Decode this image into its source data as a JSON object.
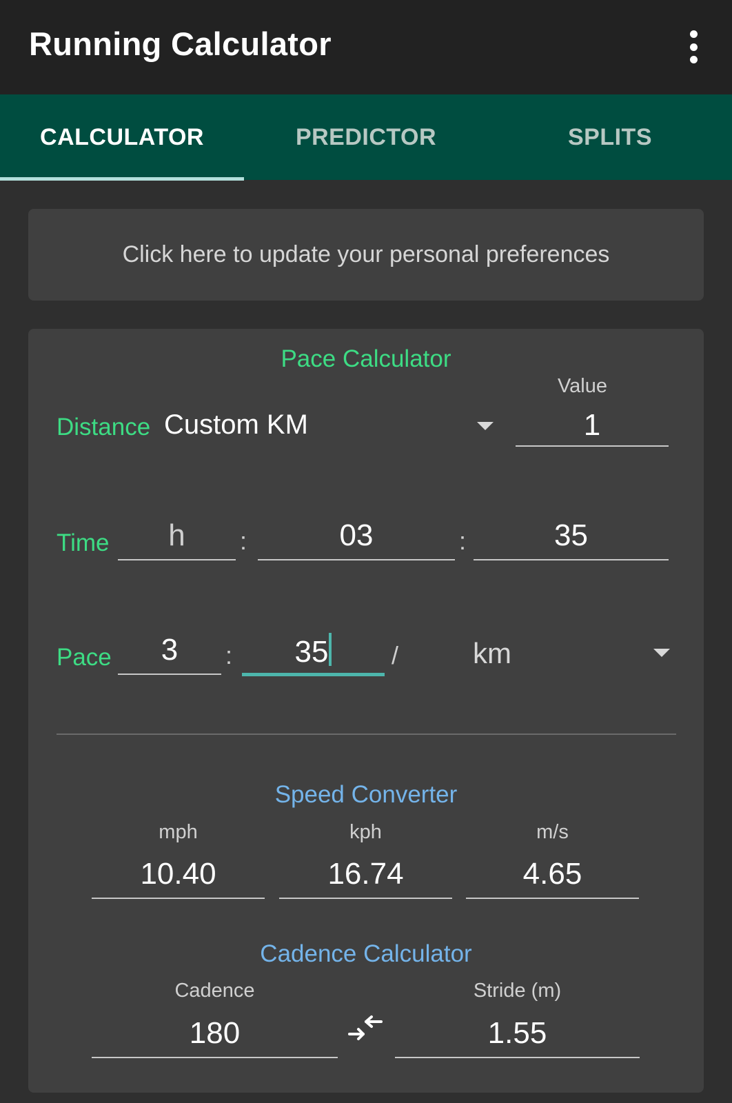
{
  "app": {
    "title": "Running Calculator"
  },
  "tabs": [
    {
      "label": "CALCULATOR",
      "active": true
    },
    {
      "label": "PREDICTOR",
      "active": false
    },
    {
      "label": "SPLITS",
      "active": false
    }
  ],
  "preferences_banner": {
    "text": "Click here to update your personal preferences"
  },
  "pace_calculator": {
    "title": "Pace Calculator",
    "distance": {
      "label": "Distance",
      "selected": "Custom KM",
      "value_label": "Value",
      "value": "1"
    },
    "time": {
      "label": "Time",
      "hours_placeholder": "h",
      "minutes": "03",
      "seconds": "35",
      "separator": ":"
    },
    "pace": {
      "label": "Pace",
      "minutes": "3",
      "seconds": "35",
      "separator": ":",
      "slash": "/",
      "unit": "km"
    }
  },
  "speed_converter": {
    "title": "Speed Converter",
    "mph_label": "mph",
    "mph": "10.40",
    "kph_label": "kph",
    "kph": "16.74",
    "ms_label": "m/s",
    "ms": "4.65"
  },
  "cadence_calculator": {
    "title": "Cadence Calculator",
    "cadence_label": "Cadence",
    "cadence": "180",
    "stride_label": "Stride (m)",
    "stride": "1.55"
  },
  "colors": {
    "appbar": "#222222",
    "tabbar": "#004d40",
    "accent_green": "#3ddc84",
    "accent_blue": "#74b4ea",
    "focus_teal": "#4db6ac"
  }
}
